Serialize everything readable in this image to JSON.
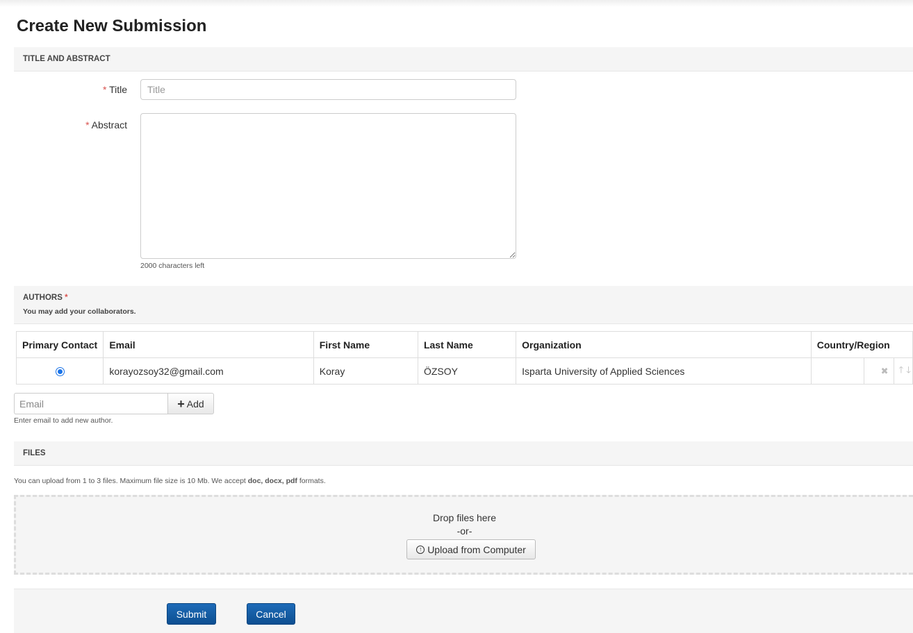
{
  "page": {
    "title": "Create New Submission"
  },
  "title_abstract": {
    "section_label": "TITLE AND ABSTRACT",
    "title_label": "Title",
    "title_placeholder": "Title",
    "abstract_label": "Abstract",
    "chars_left": "2000 characters left",
    "required_mark": "*"
  },
  "authors": {
    "section_label": "AUTHORS",
    "required_mark": "*",
    "subtitle": "You may add your collaborators.",
    "columns": [
      "Primary Contact",
      "Email",
      "First Name",
      "Last Name",
      "Organization",
      "Country/Region"
    ],
    "rows": [
      {
        "email": "korayozsoy32@gmail.com",
        "first_name": "Koray",
        "last_name": "ÖZSOY",
        "organization": "Isparta University of Applied Sciences",
        "country": ""
      }
    ],
    "add_placeholder": "Email",
    "add_label": "Add",
    "add_hint": "Enter email to add new author."
  },
  "files": {
    "section_label": "FILES",
    "info_prefix": "You can upload from 1 to 3 files. Maximum file size is 10 Mb. We accept ",
    "info_formats": "doc, docx, pdf",
    "info_suffix": " formats.",
    "drop_text": "Drop files here",
    "or_text": "-or-",
    "upload_label": "Upload from Computer"
  },
  "footer": {
    "submit_label": "Submit",
    "cancel_label": "Cancel"
  },
  "colors": {
    "primary": "#0d5aa7",
    "required": "#d9534f",
    "section_bg": "#f5f5f5"
  },
  "icons": {
    "remove": "close-icon",
    "move_up": "arrow-up-icon",
    "move_down": "arrow-down-icon",
    "add": "plus-icon",
    "upload": "upload-circle-icon"
  }
}
